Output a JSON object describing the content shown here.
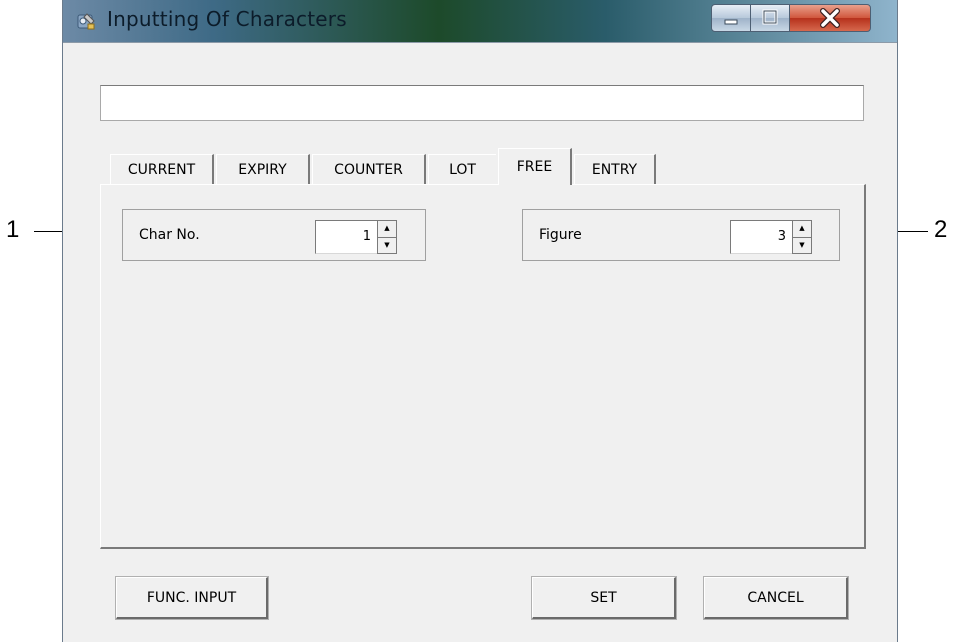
{
  "window": {
    "title": "Inputting Of Characters",
    "icon": "app-tools-icon"
  },
  "text_input": {
    "value": ""
  },
  "tabs": [
    {
      "label": "CURRENT",
      "active": false
    },
    {
      "label": "EXPIRY",
      "active": false
    },
    {
      "label": "COUNTER",
      "active": false
    },
    {
      "label": "LOT",
      "active": false
    },
    {
      "label": "FREE",
      "active": true
    },
    {
      "label": "ENTRY",
      "active": false
    }
  ],
  "fields": {
    "char_no": {
      "label": "Char No.",
      "value": "1"
    },
    "figure": {
      "label": "Figure",
      "value": "3"
    }
  },
  "buttons": {
    "func_input": "FUNC. INPUT",
    "set": "SET",
    "cancel": "CANCEL"
  },
  "callouts": {
    "left": "1",
    "right": "2"
  }
}
